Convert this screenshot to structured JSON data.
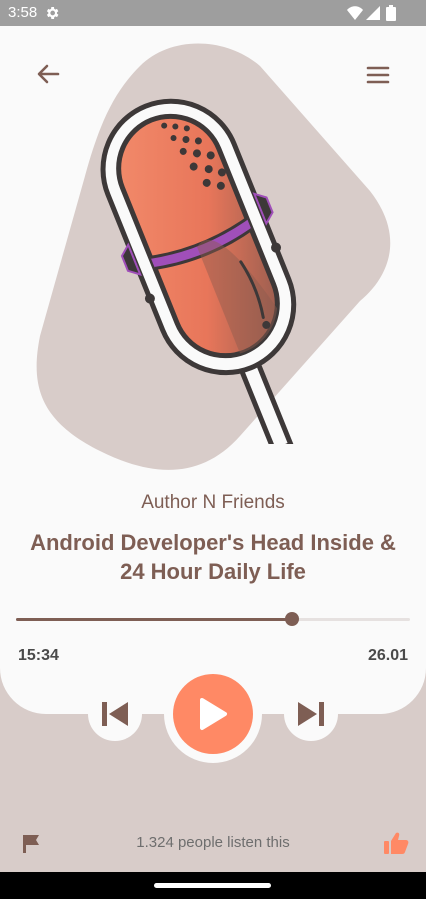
{
  "status_bar": {
    "time": "3:58",
    "icons": [
      "settings-icon",
      "wifi-icon",
      "signal-icon",
      "battery-icon"
    ]
  },
  "header": {
    "back_icon": "arrow-left-icon",
    "menu_icon": "hamburger-menu-icon"
  },
  "artwork": {
    "icon": "microphone-illustration"
  },
  "track": {
    "author": "Author N Friends",
    "title": "Android Developer's Head Inside & 24 Hour Daily Life",
    "current_time": "15:34",
    "total_time": "26.01",
    "progress": 0.7
  },
  "controls": {
    "prev_icon": "skip-previous-icon",
    "play_icon": "play-icon",
    "next_icon": "skip-next-icon"
  },
  "footer": {
    "flag_icon": "flag-icon",
    "listeners_text": "1.324 people listen this",
    "like_icon": "thumbs-up-icon"
  },
  "colors": {
    "accent": "#FF8965",
    "brown": "#7E5E54",
    "background": "#D8CCC9",
    "card": "#FAFAFA",
    "status_bar": "#9E9E9E"
  }
}
